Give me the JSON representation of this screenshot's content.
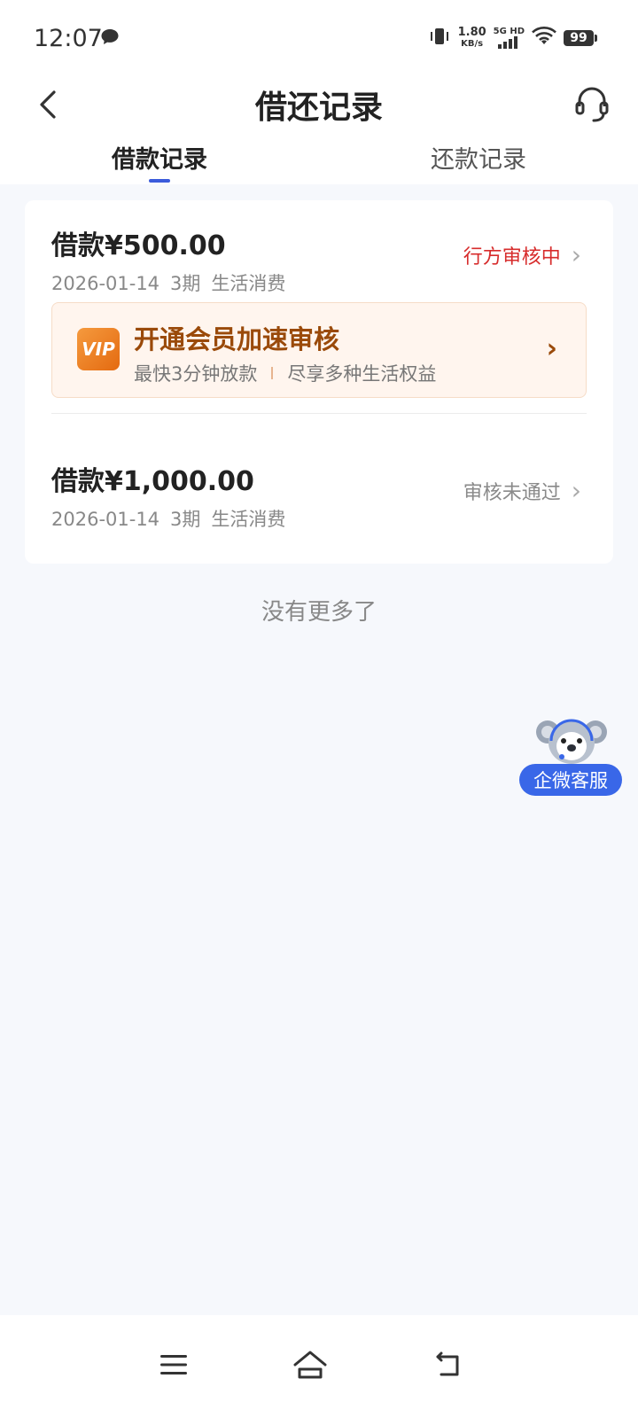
{
  "status_bar": {
    "time": "12:07",
    "net_speed_value": "1.80",
    "net_speed_unit": "KB/s",
    "network_type": "5G HD",
    "battery": "99"
  },
  "header": {
    "title": "借还记录"
  },
  "tabs": [
    {
      "label": "借款记录",
      "active": true
    },
    {
      "label": "还款记录",
      "active": false
    }
  ],
  "loans": [
    {
      "amount": "借款¥500.00",
      "date": "2026-01-14",
      "term": "3期",
      "purpose": "生活消费",
      "status": "行方审核中",
      "status_color": "#d72c2c"
    },
    {
      "amount": "借款¥1,000.00",
      "date": "2026-01-14",
      "term": "3期",
      "purpose": "生活消费",
      "status": "审核未通过",
      "status_color": "#8a8a8a"
    }
  ],
  "vip_banner": {
    "title": "开通会员加速审核",
    "subtitle_left": "最快3分钟放款",
    "subtitle_right": "尽享多种生活权益",
    "icon_text": "VIP"
  },
  "list_footer": "没有更多了",
  "floating_service": {
    "label": "企微客服"
  },
  "colors": {
    "accent": "#3b5bdb",
    "warn_red": "#d72c2c",
    "vip_brown": "#9a4a0a",
    "page_bg": "#f6f8fc"
  }
}
